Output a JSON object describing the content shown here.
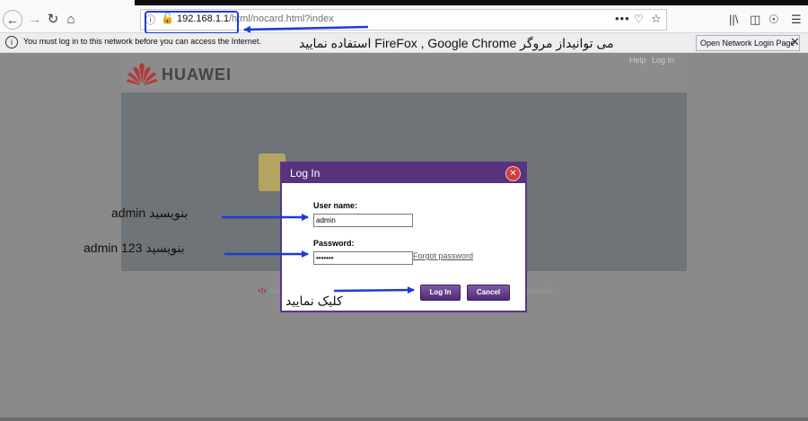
{
  "browser": {
    "url_host": "192.168.1.1",
    "url_path": "/html/nocard.html?index",
    "notification_text": "You must log in to this network before you can access the Internet.",
    "notification_button": "Open Network Login Page"
  },
  "router_page": {
    "brand": "HUAWEI",
    "header_links": [
      "Help",
      "Log In"
    ],
    "footer_left": "Co",
    "footer_right": "aderi65"
  },
  "login_dialog": {
    "title": "Log In",
    "username_label": "User name:",
    "username_value": "admin",
    "password_label": "Password:",
    "password_value": "•••••••",
    "forgot_link": "Forgot password",
    "login_button": "Log In",
    "cancel_button": "Cancel"
  },
  "annotations": {
    "browser_note": "می توانیداز مروگر FireFox , Google Chrome استفاده نمایید",
    "username_note": "بنویسید admin",
    "password_note": "بنویسید  admin 123",
    "click_note": "کلیک نمایید"
  },
  "colors": {
    "dialog_purple": "#59327e",
    "arrow_blue": "#1f3bd1",
    "insecure_red": "#d70022"
  }
}
